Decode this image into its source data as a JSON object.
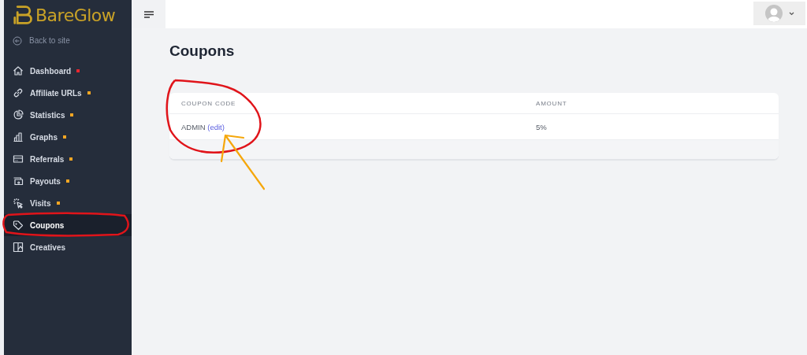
{
  "brand": {
    "name": "BareGlow"
  },
  "back_link": "Back to site",
  "nav": [
    {
      "label": "Dashboard",
      "selected": false,
      "color": "#e8262f"
    },
    {
      "label": "Affiliate URLs",
      "selected": false,
      "color": "#f5a623"
    },
    {
      "label": "Statistics",
      "selected": false,
      "color": "#f5a623"
    },
    {
      "label": "Graphs",
      "selected": false,
      "color": "#f5a623"
    },
    {
      "label": "Referrals",
      "selected": false,
      "color": "#f5a623"
    },
    {
      "label": "Payouts",
      "selected": false,
      "color": "#f5a623"
    },
    {
      "label": "Visits",
      "selected": false,
      "color": "#f5a623"
    },
    {
      "label": "Coupons",
      "selected": true
    },
    {
      "label": "Creatives",
      "selected": false
    }
  ],
  "page_title": "Coupons",
  "table": {
    "columns": [
      "COUPON CODE",
      "AMOUNT"
    ],
    "rows": [
      {
        "code": "ADMIN",
        "edit_link": "(edit)",
        "amount": "5%"
      }
    ]
  }
}
